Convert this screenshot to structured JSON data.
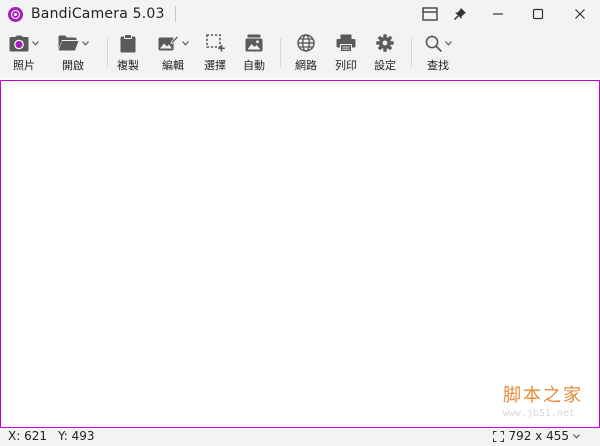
{
  "window": {
    "title": "BandiCamera 5.03",
    "accent_color": "#a020b8",
    "controls": [
      "window-mode-icon",
      "pin-icon",
      "minimize-icon",
      "maximize-icon",
      "close-icon"
    ]
  },
  "toolbar": {
    "items": [
      {
        "label": "照片",
        "icon": "camera-icon",
        "dropdown": true
      },
      {
        "label": "開啟",
        "icon": "folder-icon",
        "dropdown": true
      },
      {
        "label": "複製",
        "icon": "clipboard-icon",
        "dropdown": false
      },
      {
        "label": "編輯",
        "icon": "edit-image-icon",
        "dropdown": true
      },
      {
        "label": "選擇",
        "icon": "select-region-icon",
        "dropdown": false
      },
      {
        "label": "自動",
        "icon": "auto-capture-icon",
        "dropdown": false
      },
      {
        "label": "網路",
        "icon": "globe-icon",
        "dropdown": false
      },
      {
        "label": "列印",
        "icon": "printer-icon",
        "dropdown": false
      },
      {
        "label": "設定",
        "icon": "gear-icon",
        "dropdown": false
      },
      {
        "label": "查找",
        "icon": "search-icon",
        "dropdown": true
      }
    ]
  },
  "canvas": {
    "border_color": "#c000d8",
    "watermark_brand": "脚本之家",
    "watermark_url": "www.jb51.net"
  },
  "status": {
    "x": "X: 621",
    "y": "Y: 493",
    "size": "792 x 455"
  }
}
